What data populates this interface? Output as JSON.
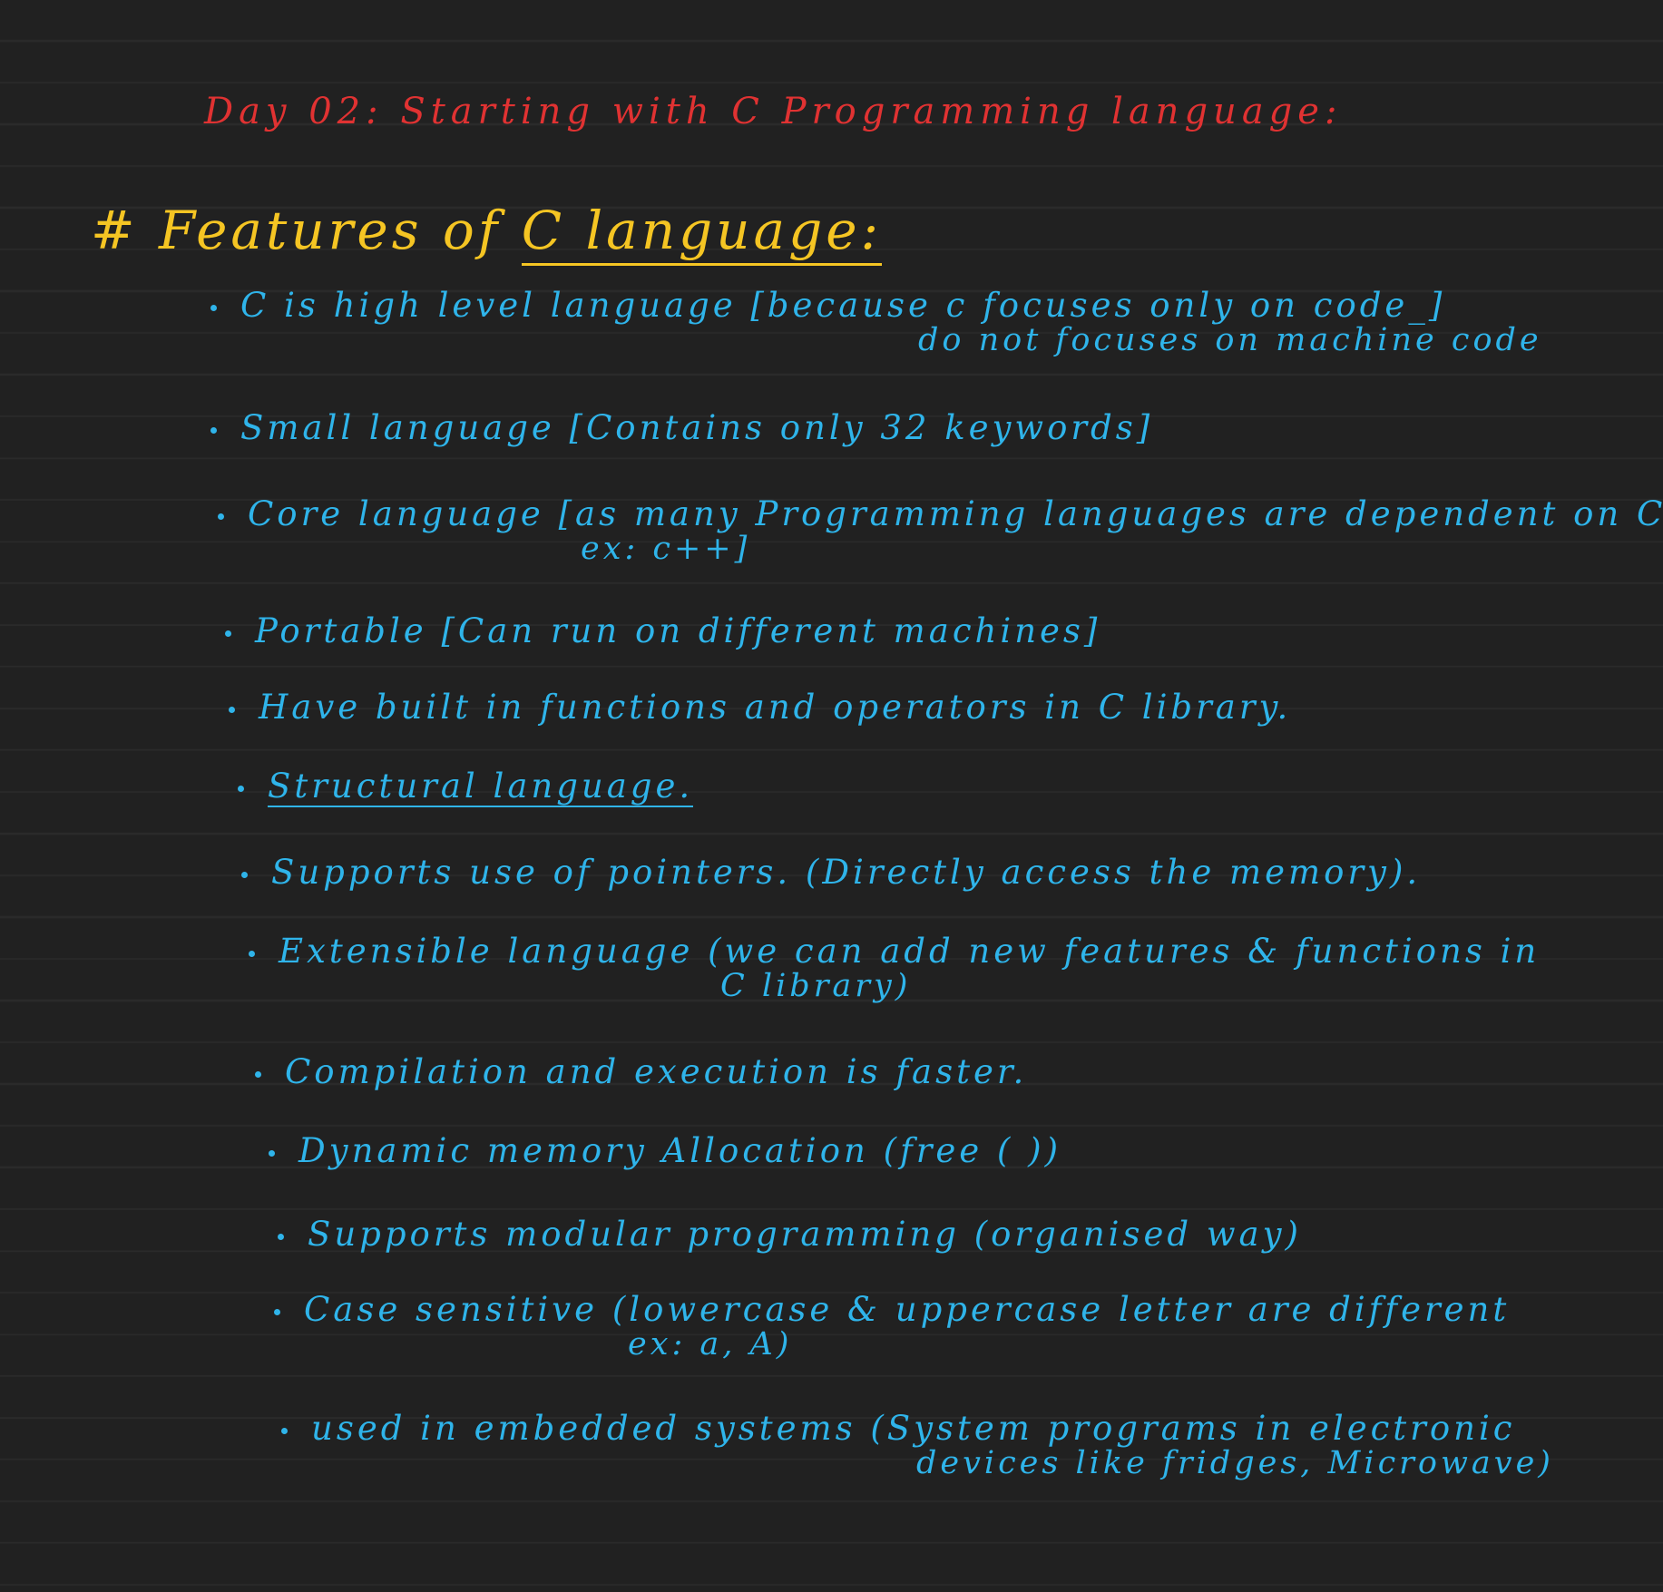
{
  "note": {
    "title": "Day 02: Starting with C Programming language:",
    "heading_prefix": "# Features of ",
    "heading_underlined": "C language:",
    "bullets": [
      {
        "line1": "C is high level language [because c focuses only on code_]",
        "line2": "do not focuses on machine code"
      },
      {
        "line1": "Small language [Contains only 32 keywords]",
        "line2": ""
      },
      {
        "line1": "Core language [as many Programming languages are dependent on C",
        "line2": "ex: c++]"
      },
      {
        "line1": "Portable [Can run on different machines]",
        "line2": ""
      },
      {
        "line1": "Have built in functions and operators in C library.",
        "line2": ""
      },
      {
        "line1": "Structural language.",
        "line2": ""
      },
      {
        "line1": "Supports use of pointers. (Directly access the memory).",
        "line2": ""
      },
      {
        "line1": "Extensible language (we can add new features & functions in",
        "line2": "C library)"
      },
      {
        "line1": "Compilation and execution is faster.",
        "line2": ""
      },
      {
        "line1": "Dynamic memory Allocation (free ( ))",
        "line2": ""
      },
      {
        "line1": "Supports modular programming (organised way)",
        "line2": ""
      },
      {
        "line1": "Case sensitive (lowercase & uppercase letter are different",
        "line2": "ex: a, A)"
      },
      {
        "line1": "used in embedded systems (System programs in electronic",
        "line2": "devices like fridges, Microwave)"
      }
    ]
  },
  "colors": {
    "background": "#212121",
    "title": "#e03232",
    "heading": "#f5c523",
    "body": "#2fb4ea"
  }
}
